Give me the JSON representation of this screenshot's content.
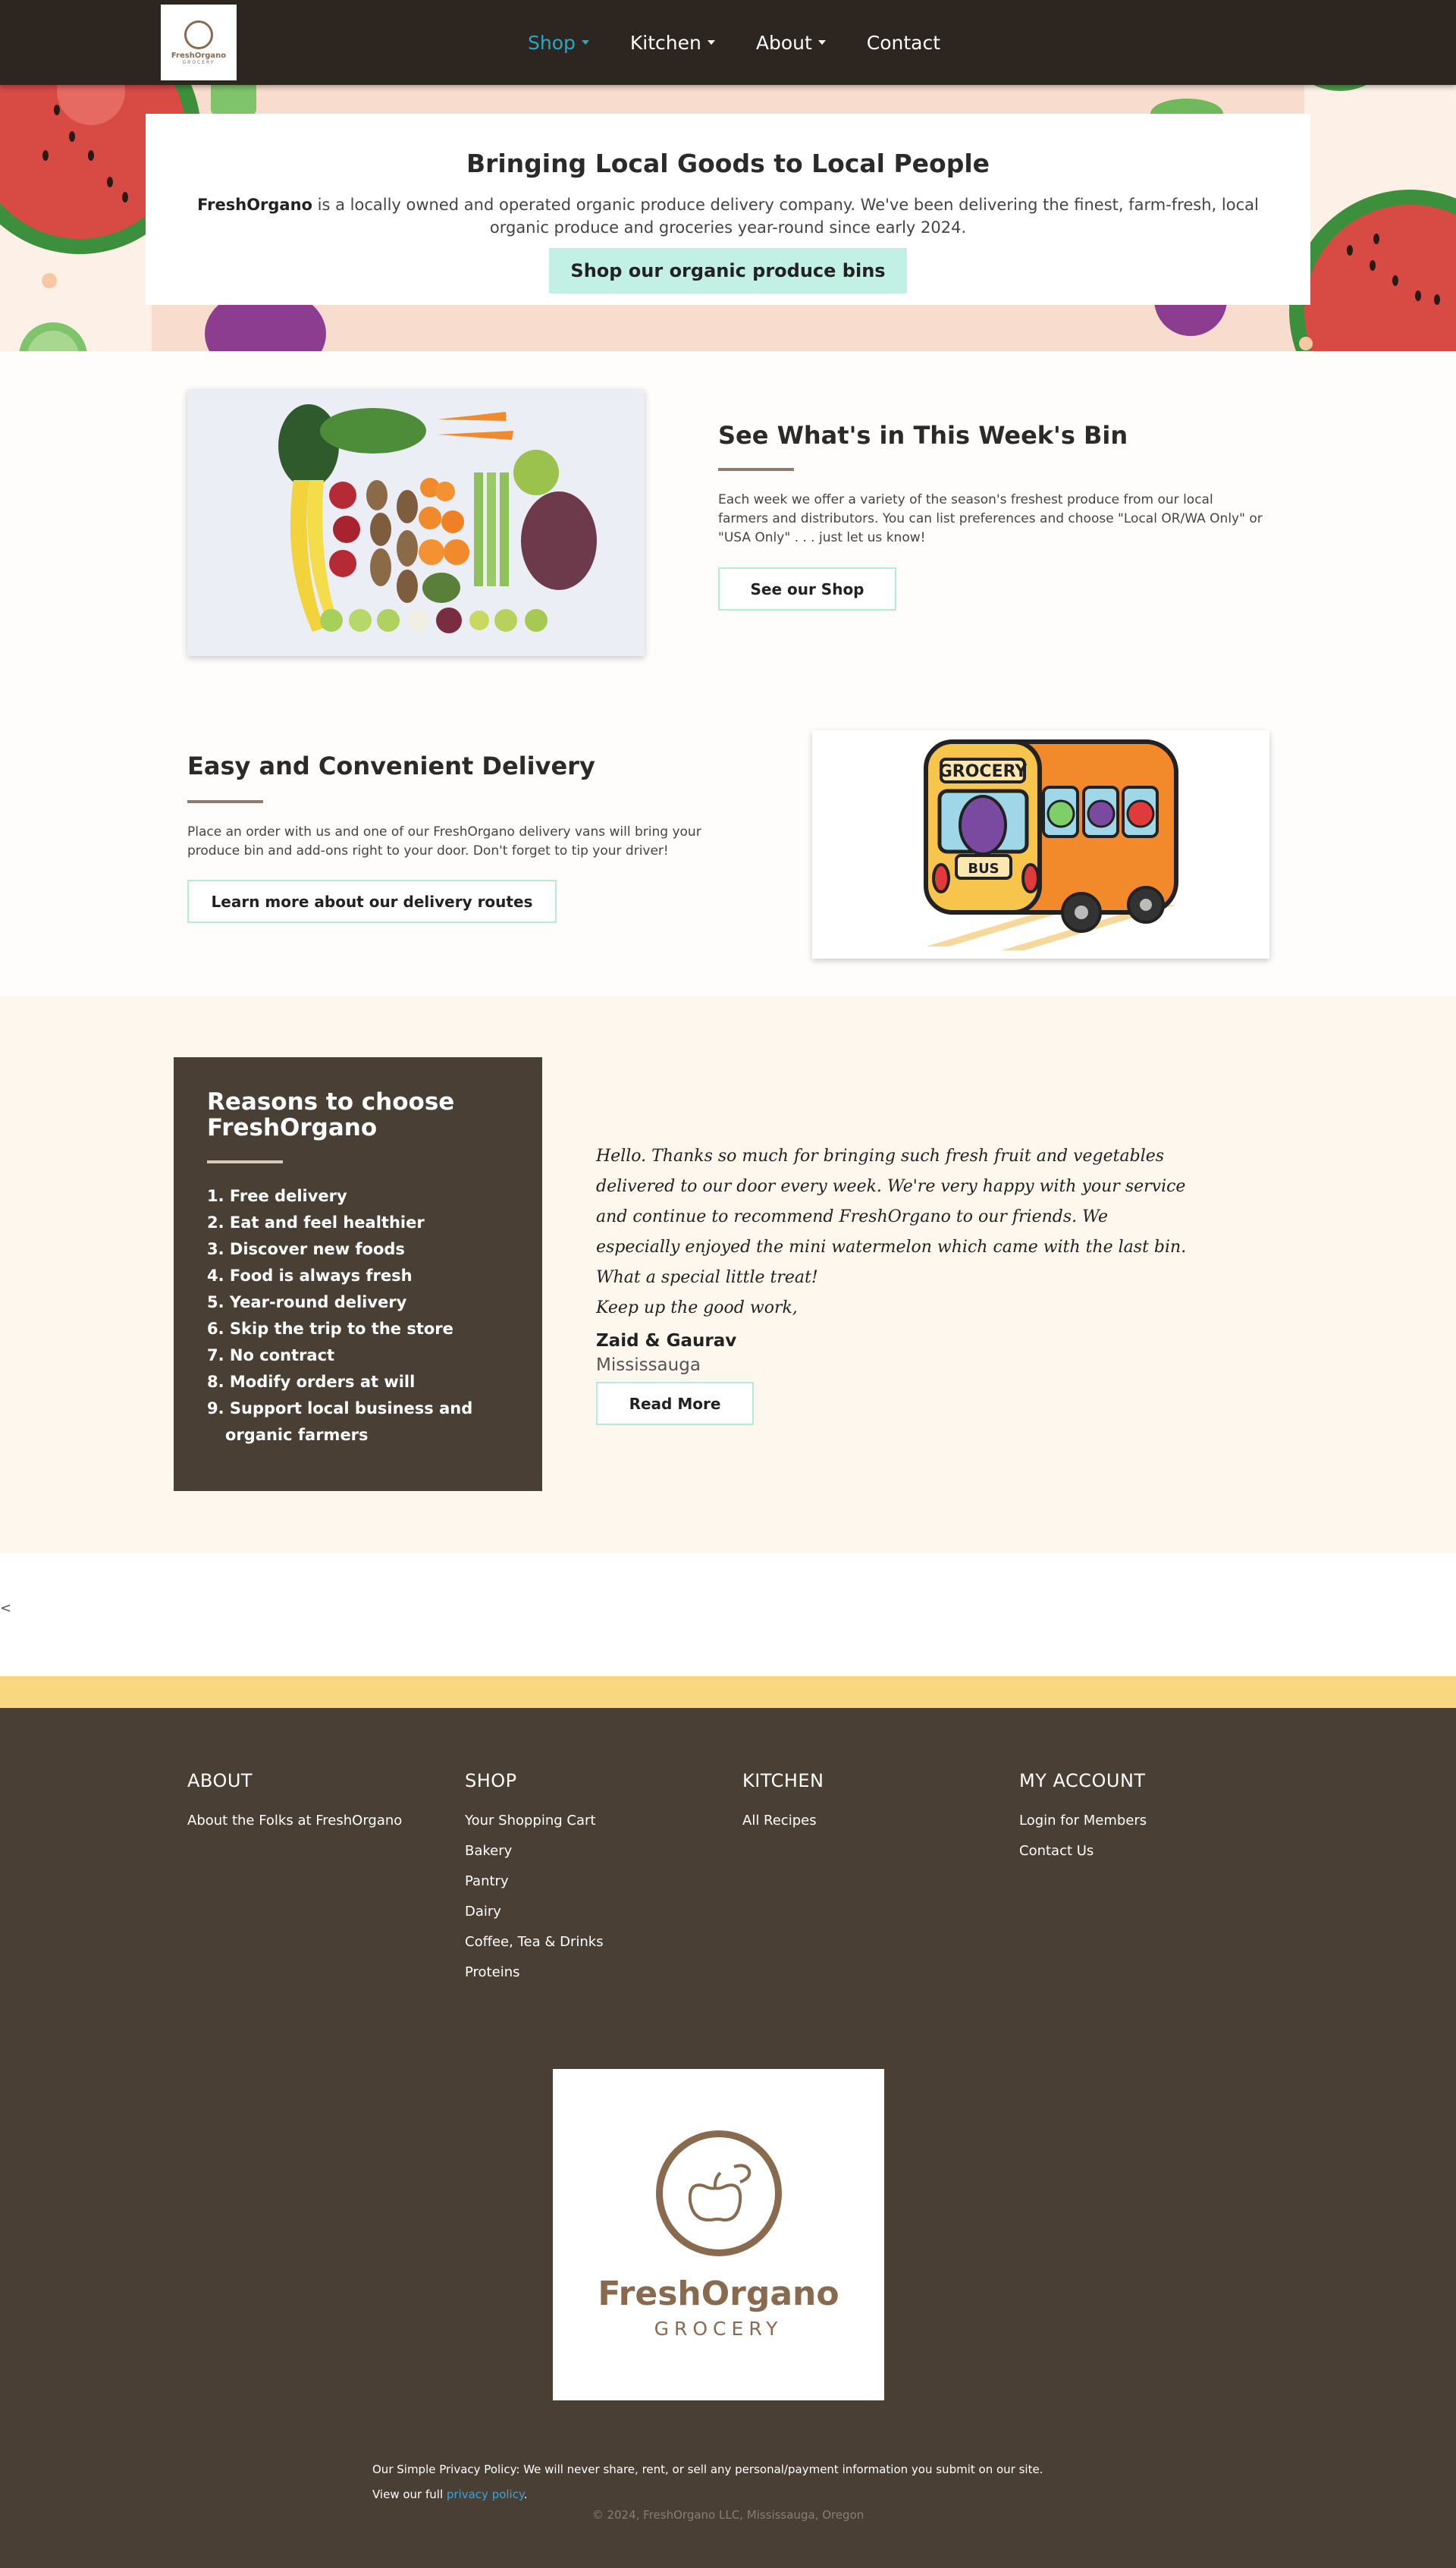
{
  "nav": {
    "logo_brand": "FreshOrgano",
    "logo_sub": "GROCERY",
    "items": [
      {
        "label": "Shop",
        "dropdown": true,
        "active": true
      },
      {
        "label": "Kitchen",
        "dropdown": true,
        "active": false
      },
      {
        "label": "About",
        "dropdown": true,
        "active": false
      },
      {
        "label": "Contact",
        "dropdown": false,
        "active": false
      }
    ]
  },
  "hero": {
    "title": "Bringing Local Goods to Local People",
    "brand": "FreshOrgano",
    "text": " is a locally owned and operated organic produce delivery company. We've been delivering the finest, farm-fresh, local organic produce and groceries year-round since early 2024.",
    "button": "Shop our organic produce bins"
  },
  "bin": {
    "title": "See What's in This Week's Bin",
    "text": "Each week we offer a variety of the season's freshest produce from our local farmers and distributors. You can list preferences and choose \"Local OR/WA Only\" or \"USA Only\" . . . just let us know!",
    "button": "See our Shop"
  },
  "delivery": {
    "title": "Easy and Convenient Delivery",
    "text": "Place an order with us and one of our FreshOrgano delivery vans will bring your produce bin and add-ons right to your door. Don't forget to tip your driver!",
    "button": "Learn more about our delivery routes",
    "bus_sign": "GROCERY",
    "bus_label": "BUS"
  },
  "reasons": {
    "title": "Reasons to choose FreshOrgano",
    "items": [
      "1. Free delivery",
      "2. Eat and feel healthier",
      "3. Discover new foods",
      "4. Food is always fresh",
      "5. Year-round delivery",
      "6. Skip the trip to the store",
      "7. No contract",
      "8. Modify orders at will",
      "9. Support local business and organic farmers"
    ]
  },
  "testimonial": {
    "quote": "Hello. Thanks so much for bringing such fresh fruit and vegetables delivered to our door every week. We're very happy with your service and continue to recommend FreshOrgano to our friends. We especially enjoyed the mini watermelon which came with the last bin. What a special little treat!",
    "signoff": "Keep up the good work,",
    "name": "Zaid & Gaurav",
    "place": "Mississauga",
    "button": "Read More"
  },
  "stray_char": "<",
  "footer": {
    "columns": [
      {
        "heading": "ABOUT",
        "links": [
          "About the Folks at FreshOrgano"
        ]
      },
      {
        "heading": "SHOP",
        "links": [
          "Your Shopping Cart",
          "Bakery",
          "Pantry",
          "Dairy",
          "Coffee, Tea & Drinks",
          "Proteins"
        ]
      },
      {
        "heading": "KITCHEN",
        "links": [
          "All Recipes"
        ]
      },
      {
        "heading": "MY ACCOUNT",
        "links": [
          "Login for Members",
          "Contact Us"
        ]
      }
    ],
    "logo_brand": "FreshOrgano",
    "logo_sub": "GROCERY",
    "privacy_line": "Our Simple Privacy Policy: We will never share, rent, or sell any personal/payment information you submit on our site.",
    "view_prefix": "View our full ",
    "privacy_link": "privacy policy",
    "view_suffix": ".",
    "copyright": "© 2024, FreshOrgano LLC, Mississauga, Oregon"
  },
  "colors": {
    "nav_bg": "#2d2520",
    "accent_link": "#26a9c6",
    "mint": "#c3f0e4",
    "brown": "#4a3f35",
    "yellow": "#f9d680",
    "logo_brown": "#8a6a4f"
  }
}
